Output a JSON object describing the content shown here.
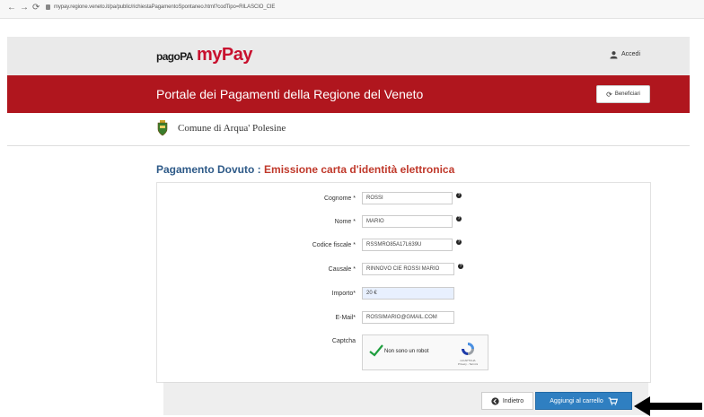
{
  "browser": {
    "url": "mypay.regione.veneto.it/pa/public/richiestaPagamentoSpontaneo.html?codTipo=RILASCIO_CIE"
  },
  "header": {
    "logo_pagopa": "pagoPA",
    "logo_mypay": "myPay",
    "login_label": "Accedi"
  },
  "portal": {
    "title": "Portale dei Pagamenti della Regione del Veneto",
    "beneficiari_label": "Beneficiari"
  },
  "comune": {
    "name": "Comune di Arqua' Polesine"
  },
  "page": {
    "title_prefix": "Pagamento Dovuto : ",
    "title_main": "Emissione carta d'identità elettronica"
  },
  "form": {
    "cognome": {
      "label": "Cognome *",
      "value": "ROSSI"
    },
    "nome": {
      "label": "Nome *",
      "value": "MARIO"
    },
    "codice_fiscale": {
      "label": "Codice fiscale *",
      "value": "RSSMRO85A17L639U"
    },
    "causale": {
      "label": "Causale *",
      "value": "RINNOVO CIE ROSSI MARIO"
    },
    "importo": {
      "label": "Importo*",
      "value": "20 €"
    },
    "email": {
      "label": "E-Mail*",
      "value": "ROSSIMARIO@GMAIL.COM"
    },
    "captcha": {
      "label": "Captcha",
      "text": "Non sono un robot",
      "brand": "reCAPTCHA",
      "links": "Privacy - Termini"
    },
    "help_glyph": "?"
  },
  "actions": {
    "back_label": "Indietro",
    "add_cart_label": "Aggiungi al carrello"
  },
  "colors": {
    "brand_red": "#b0161e",
    "button_blue": "#2f7fc1",
    "title_blue": "#2e5a88",
    "title_red": "#c0392b"
  }
}
